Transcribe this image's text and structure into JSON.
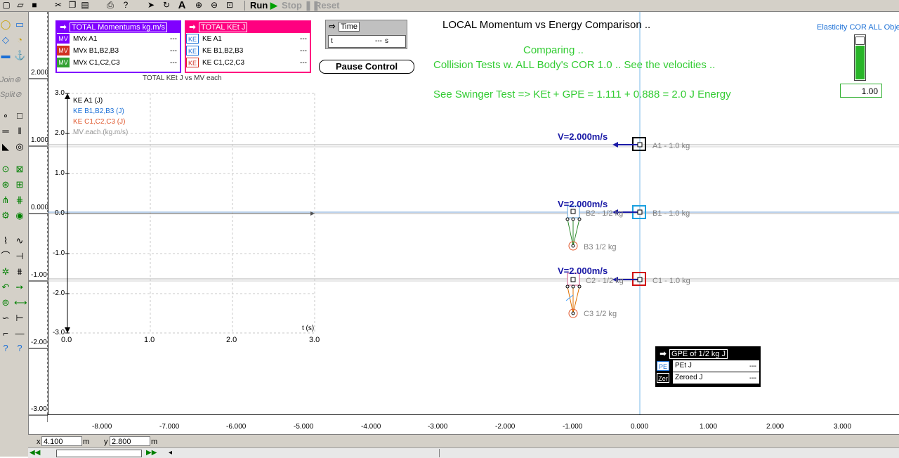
{
  "toolbar": {
    "run_label": "Run",
    "stop_label": "Stop",
    "reset_label": "Reset"
  },
  "palette": {
    "join_label": "Join",
    "split_label": "Split"
  },
  "title": "LOCAL Momentum vs Energy Comparison ..",
  "subtitle_lines": {
    "l1": "Comparing ..",
    "l2": "Collision Tests w. ALL Body's COR 1.0 .. See the velocities ..",
    "l3": "See Swinger Test => KEt + GPE = 1.111 + 0.888 = 2.0 J Energy"
  },
  "meters": {
    "momentum": {
      "title": "TOTAL Momentums kg.m/s",
      "rows": [
        {
          "tag": "MV",
          "label": "MVx A1",
          "value": "---"
        },
        {
          "tag": "MV",
          "label": "MVx B1,B2,B3",
          "value": "---"
        },
        {
          "tag": "MV",
          "label": "MVx C1,C2,C3",
          "value": "---"
        }
      ]
    },
    "ke": {
      "title": "TOTAL KEt J",
      "rows": [
        {
          "tag": "KE",
          "label": "KE A1",
          "value": "---"
        },
        {
          "tag": "KE",
          "label": "KE B1,B2,B3",
          "value": "---"
        },
        {
          "tag": "KE",
          "label": "KE C1,C2,C3",
          "value": "---"
        }
      ]
    },
    "time": {
      "title": "Time",
      "var": "t",
      "value": "---",
      "unit": "s"
    },
    "gpe": {
      "title": "GPE of 1/2 kg J",
      "rows": [
        {
          "tag": "PE",
          "label": "PEt J",
          "value": "---"
        },
        {
          "tag": "Zer",
          "label": "Zeroed J",
          "value": "---"
        }
      ]
    }
  },
  "pause_button": "Pause Control",
  "slider": {
    "title": "Elasticity COR ALL Objec",
    "value": "1.00",
    "level": 0.95
  },
  "graph": {
    "caption": "TOTAL KEt J vs MV each",
    "legend": [
      "KE A1 (J)",
      "KE B1,B2,B3 (J)",
      "KE C1,C2,C3 (J)",
      "MV each (kg.m/s)"
    ],
    "y_ticks": [
      "3.0",
      "2.0",
      "1.0",
      "0.0",
      "-1.0",
      "-2.0",
      "-3.0"
    ],
    "x_ticks": [
      "0.0",
      "1.0",
      "2.0",
      "3.0"
    ],
    "x_label": "t (s)"
  },
  "world": {
    "vruler": [
      "2.000",
      "1.000",
      "0.000",
      "-1.00",
      "-2.00",
      "-3.00"
    ],
    "hruler": [
      "-8.000",
      "-7.000",
      "-6.000",
      "-5.000",
      "-4.000",
      "-3.000",
      "-2.000",
      "-1.000",
      "0.000",
      "1.000",
      "2.000",
      "3.000"
    ],
    "velocity_label": "V=2.000m/s",
    "bodies": {
      "a1": "A1 - 1.0 kg",
      "b1": "B1 - 1.0 kg",
      "b2": "B2 - 1/2 kg",
      "b3": "B3 1/2 kg",
      "c1": "C1 - 1.0 kg",
      "c2": "C2 - 1/2 kg",
      "c3": "C3 1/2 kg"
    }
  },
  "status": {
    "x_label": "x",
    "x_value": "4.100",
    "y_label": "y",
    "y_value": "2.800",
    "unit": "m"
  },
  "colors": {
    "momentum_meter": "#8000ff",
    "ke_meter": "#ff0080",
    "green_text": "#33cc33",
    "velocity": "#1a1aa6"
  }
}
